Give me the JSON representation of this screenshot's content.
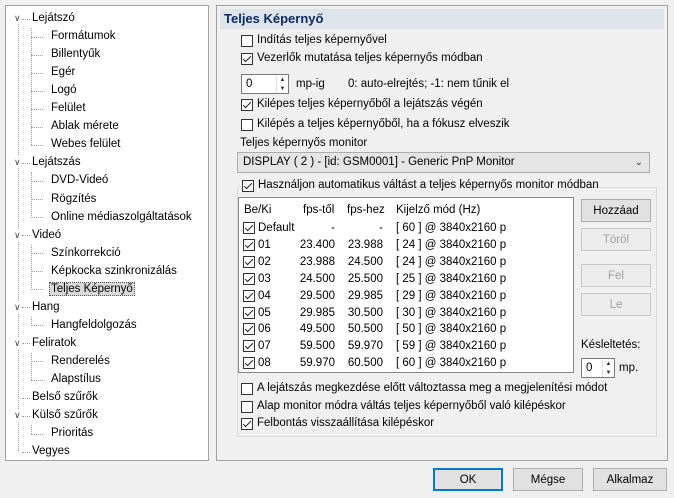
{
  "tree": {
    "items": [
      {
        "label": "Lejátszó",
        "level": 0,
        "expanded": true
      },
      {
        "label": "Formátumok",
        "level": 1
      },
      {
        "label": "Billentyűk",
        "level": 1
      },
      {
        "label": "Egér",
        "level": 1
      },
      {
        "label": "Logó",
        "level": 1
      },
      {
        "label": "Felület",
        "level": 1
      },
      {
        "label": "Ablak mérete",
        "level": 1
      },
      {
        "label": "Webes felület",
        "level": 1
      },
      {
        "label": "Lejátszás",
        "level": 0,
        "expanded": true
      },
      {
        "label": "DVD-Videó",
        "level": 1
      },
      {
        "label": "Rögzítés",
        "level": 1
      },
      {
        "label": "Online médiaszolgáltatások",
        "level": 1
      },
      {
        "label": "Videó",
        "level": 0,
        "expanded": true
      },
      {
        "label": "Színkorrekció",
        "level": 1
      },
      {
        "label": "Képkocka szinkronizálás",
        "level": 1
      },
      {
        "label": "Teljes Képernyő",
        "level": 1,
        "selected": true
      },
      {
        "label": "Hang",
        "level": 0,
        "expanded": true
      },
      {
        "label": "Hangfeldolgozás",
        "level": 1
      },
      {
        "label": "Feliratok",
        "level": 0,
        "expanded": true
      },
      {
        "label": "Renderelés",
        "level": 1
      },
      {
        "label": "Alapstílus",
        "level": 1
      },
      {
        "label": "Belső szűrők",
        "level": 0
      },
      {
        "label": "Külső szűrők",
        "level": 0,
        "expanded": true
      },
      {
        "label": "Prioritás",
        "level": 1
      },
      {
        "label": "Vegyes",
        "level": 0
      }
    ]
  },
  "panel": {
    "title": "Teljes Képernyő",
    "launch_fullscreen": {
      "label": "Indítás teljes képernyővel",
      "checked": false
    },
    "show_controls": {
      "label": "Vezerlők mutatása teljes képernyős módban",
      "checked": true
    },
    "hide_delay": {
      "value": "0",
      "unit": "mp-ig",
      "hint": "0: auto-elrejtés; -1: nem tűnik el"
    },
    "exit_at_end": {
      "label": "Kilépes teljes képernyőből a lejátszás végén",
      "checked": true
    },
    "exit_on_focus_loss": {
      "label": "Kilépés a teljes képernyőből, ha a fókusz elveszik",
      "checked": false
    },
    "monitor_label": "Teljes képernyős monitor",
    "monitor_value": "DISPLAY ( 2 ) - [id: GSM0001] - Generic PnP Monitor",
    "auto_switch": {
      "label": "Használjon automatikus váltást a teljes képernyős monitor módban",
      "checked": true
    },
    "list": {
      "headers": [
        "Be/Ki",
        "fps-től",
        "fps-hez",
        "Kijelző mód (Hz)"
      ],
      "rows": [
        {
          "checked": true,
          "name": "Default",
          "from": "-",
          "to": "-",
          "mode": "[ 60 ]  @ 3840x2160 p"
        },
        {
          "checked": true,
          "name": "01",
          "from": "23.400",
          "to": "23.988",
          "mode": "[ 24 ]  @ 3840x2160 p"
        },
        {
          "checked": true,
          "name": "02",
          "from": "23.988",
          "to": "24.500",
          "mode": "[ 24 ]  @ 3840x2160 p"
        },
        {
          "checked": true,
          "name": "03",
          "from": "24.500",
          "to": "25.500",
          "mode": "[ 25 ]  @ 3840x2160 p"
        },
        {
          "checked": true,
          "name": "04",
          "from": "29.500",
          "to": "29.985",
          "mode": "[ 29 ]  @ 3840x2160 p"
        },
        {
          "checked": true,
          "name": "05",
          "from": "29.985",
          "to": "30.500",
          "mode": "[ 30 ]  @ 3840x2160 p"
        },
        {
          "checked": true,
          "name": "06",
          "from": "49.500",
          "to": "50.500",
          "mode": "[ 50 ]  @ 3840x2160 p"
        },
        {
          "checked": true,
          "name": "07",
          "from": "59.500",
          "to": "59.970",
          "mode": "[ 59 ]  @ 3840x2160 p"
        },
        {
          "checked": true,
          "name": "08",
          "from": "59.970",
          "to": "60.500",
          "mode": "[ 60 ]  @ 3840x2160 p"
        }
      ]
    },
    "buttons": {
      "add": "Hozzáad",
      "delete": "Töröl",
      "up": "Fel",
      "down": "Le"
    },
    "delay": {
      "label": "Késleltetés:",
      "value": "0",
      "unit": "mp."
    },
    "apply_before_play": {
      "label": "A lejátszás megkezdése előtt változtassa meg a megjelenítési módot",
      "checked": false
    },
    "restore_on_exit": {
      "label": "Alap monitor módra váltás teljes képernyőből való kilépéskor",
      "checked": false
    },
    "resolution_restore": {
      "label": "Felbontás visszaállítása kilépéskor",
      "checked": true
    }
  },
  "footer": {
    "ok": "OK",
    "cancel": "Mégse",
    "apply": "Alkalmaz"
  }
}
